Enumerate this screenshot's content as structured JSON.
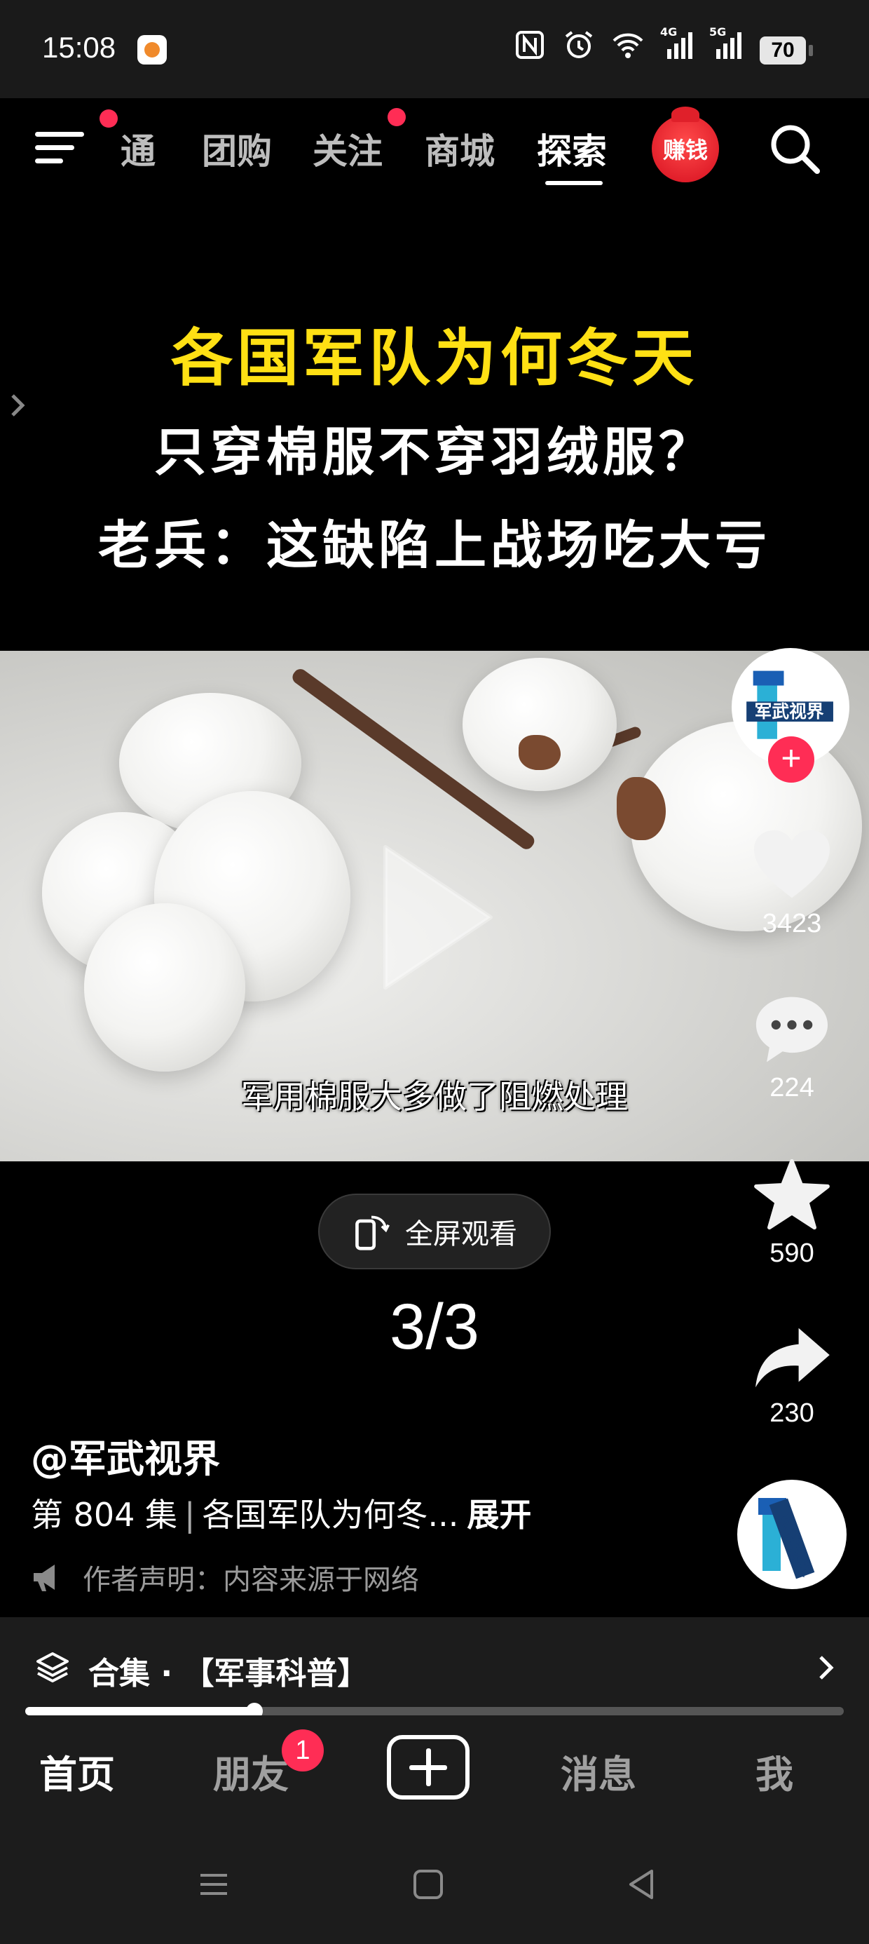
{
  "status_bar": {
    "time": "15:08",
    "network_4g": "4G",
    "network_5g": "5G",
    "battery": "70",
    "icons": [
      "nfc-icon",
      "alarm-icon",
      "wifi-icon",
      "signal-4g-icon",
      "signal-5g-icon"
    ]
  },
  "top_nav": {
    "tabs": [
      {
        "label": "通"
      },
      {
        "label": "团购"
      },
      {
        "label": "关注"
      },
      {
        "label": "商城"
      },
      {
        "label": "探索"
      }
    ],
    "active_tab": "探索",
    "earn_label": "赚钱"
  },
  "video": {
    "title_line1": "各国军队为何冬天",
    "title_line2": "只穿棉服不穿羽绒服？",
    "title_line3": "老兵：这缺陷上战场吃大亏",
    "subtitle": "军用棉服大多做了阻燃处理",
    "fullscreen_label": "全屏观看",
    "page_indicator": "3/3",
    "progress": 0.28
  },
  "sidebar": {
    "like_count": "3423",
    "comment_count": "224",
    "favorite_count": "590",
    "share_count": "230",
    "follow_symbol": "+"
  },
  "info": {
    "author": "@军武视界",
    "episode_prefix": "第 804 集",
    "episode_title": "各国军队为何冬...",
    "expand_label": "展开",
    "disclaimer": "作者声明：内容来源于网络"
  },
  "collection": {
    "label": "合集 · 【军事科普】"
  },
  "tab_bar": {
    "home": "首页",
    "friends": "朋友",
    "friends_badge": "1",
    "messages": "消息",
    "me": "我"
  },
  "colors": {
    "accent_red": "#ff2d55",
    "title_yellow": "#ffe014"
  }
}
